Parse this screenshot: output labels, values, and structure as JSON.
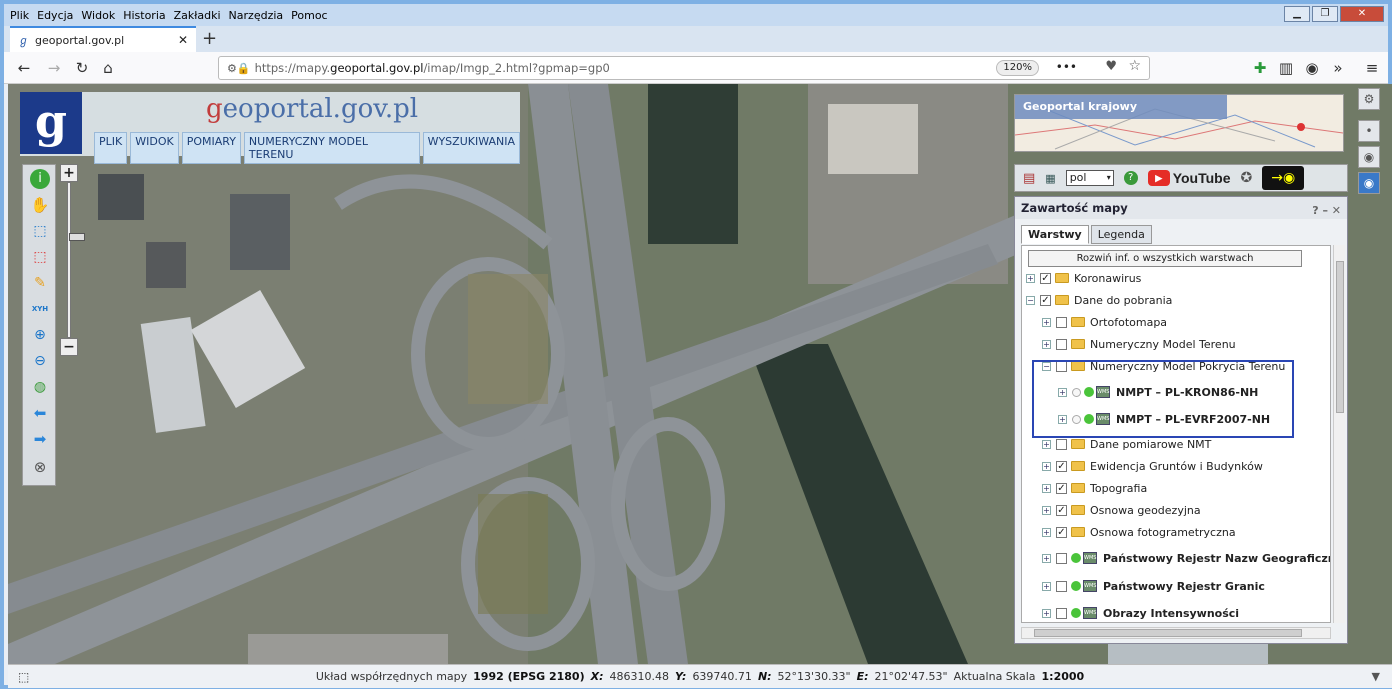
{
  "browser": {
    "menu": [
      "Plik",
      "Edycja",
      "Widok",
      "Historia",
      "Zakładki",
      "Narzędzia",
      "Pomoc"
    ],
    "tab_title": "geoportal.gov.pl",
    "url_prefix": "https://mapy.",
    "url_domain": "geoportal.gov.pl",
    "url_path": "/imap/Imgp_2.html?gpmap=gp0",
    "zoom_level": "120%"
  },
  "app": {
    "logo_letter": "g",
    "brand_g": "g",
    "brand_rest": "eoportal.gov.pl",
    "menu": [
      "PLIK",
      "WIDOK",
      "POMIARY",
      "NUMERYCZNY MODEL TERENU",
      "WYSZUKIWANIA"
    ],
    "overview_label": "Geoportal krajowy",
    "tool_xyh": "XYH",
    "lang": "pol",
    "youtube": "YouTube"
  },
  "panel": {
    "title": "Zawartość mapy",
    "tabs": [
      "Warstwy",
      "Legenda"
    ],
    "expand_all": "Rozwiń inf. o wszystkich warstwach",
    "rows": [
      {
        "label": "Koronawirus",
        "indent": 0,
        "pm": "+",
        "checked": true,
        "kind": "folder"
      },
      {
        "label": "Dane do pobrania",
        "indent": 0,
        "pm": "−",
        "checked": true,
        "kind": "folder"
      },
      {
        "label": "Ortofotomapa",
        "indent": 1,
        "pm": "+",
        "checked": false,
        "kind": "folder"
      },
      {
        "label": "Numeryczny Model Terenu",
        "indent": 1,
        "pm": "+",
        "checked": false,
        "kind": "folder"
      },
      {
        "label": "Numeryczny Model Pokrycia Terenu",
        "indent": 1,
        "pm": "−",
        "checked": false,
        "kind": "folder"
      },
      {
        "label": "NMPT – PL-KRON86-NH",
        "indent": 2,
        "pm": "+",
        "checked": false,
        "kind": "wms"
      },
      {
        "label": "NMPT – PL-EVRF2007-NH",
        "indent": 2,
        "pm": "+",
        "checked": false,
        "kind": "wms"
      },
      {
        "label": "Dane pomiarowe NMT",
        "indent": 1,
        "pm": "+",
        "checked": false,
        "kind": "folder"
      },
      {
        "label": "Ewidencja Gruntów i Budynków",
        "indent": 1,
        "pm": "+",
        "checked": true,
        "kind": "folder"
      },
      {
        "label": "Topografia",
        "indent": 1,
        "pm": "+",
        "checked": true,
        "kind": "folder"
      },
      {
        "label": "Osnowa geodezyjna",
        "indent": 1,
        "pm": "+",
        "checked": true,
        "kind": "folder"
      },
      {
        "label": "Osnowa fotogrametryczna",
        "indent": 1,
        "pm": "+",
        "checked": true,
        "kind": "folder"
      },
      {
        "label": "Państwowy Rejestr Nazw Geograficznych",
        "indent": 1,
        "pm": "+",
        "checked": false,
        "kind": "wms"
      },
      {
        "label": "Państwowy Rejestr Granic",
        "indent": 1,
        "pm": "+",
        "checked": false,
        "kind": "wms"
      },
      {
        "label": "Obrazy Intensywności",
        "indent": 1,
        "pm": "+",
        "checked": false,
        "kind": "wms"
      }
    ]
  },
  "status": {
    "crs_label": "Układ współrzędnych mapy",
    "crs_value": "1992 (EPSG 2180)",
    "x_label": "X:",
    "x_value": "486310.48",
    "y_label": "Y:",
    "y_value": "639740.71",
    "n_label": "N:",
    "n_value": "52°13'30.33\"",
    "e_label": "E:",
    "e_value": "21°02'47.53\"",
    "scale_label": "Aktualna Skala",
    "scale_value": "1:2000"
  }
}
